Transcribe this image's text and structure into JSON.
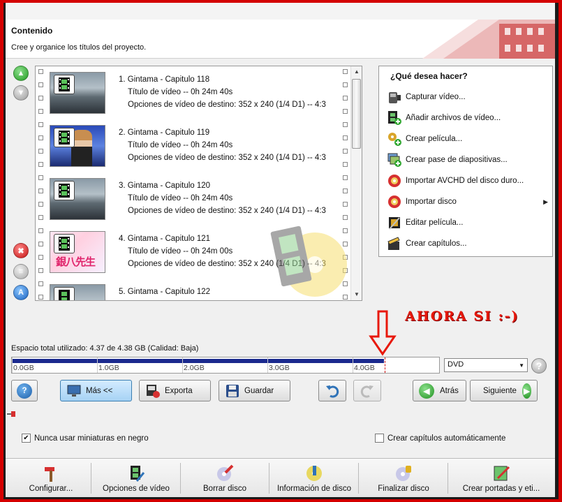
{
  "header": {
    "title": "Contenido",
    "subtitle": "Cree y organice los títulos del proyecto."
  },
  "titles": [
    {
      "name": "1. Gintama - Capitulo 118",
      "duration": "Título de vídeo -- 0h 24m 40s",
      "options": "Opciones de vídeo de destino: 352 x 240 (1/4 D1) -- 4:3"
    },
    {
      "name": "2. Gintama - Capitulo 119",
      "duration": "Título de vídeo -- 0h 24m 40s",
      "options": "Opciones de vídeo de destino: 352 x 240 (1/4 D1) -- 4:3"
    },
    {
      "name": "3. Gintama - Capitulo 120",
      "duration": "Título de vídeo -- 0h 24m 40s",
      "options": "Opciones de vídeo de destino: 352 x 240 (1/4 D1) -- 4:3"
    },
    {
      "name": "4. Gintama - Capitulo 121",
      "duration": "Título de vídeo -- 0h 24m 00s",
      "options": "Opciones de vídeo de destino: 352 x 240 (1/4 D1) -- 4:3"
    },
    {
      "name": "5. Gintama - Capitulo 122",
      "duration": "",
      "options": ""
    }
  ],
  "thumb_text": {
    "anime2": "銀八先生"
  },
  "tasks": {
    "heading": "¿Qué desea hacer?",
    "items": [
      {
        "label": "Capturar vídeo...",
        "icon": "camcorder-icon"
      },
      {
        "label": "Añadir archivos de vídeo...",
        "icon": "add-video-file-icon"
      },
      {
        "label": "Crear película...",
        "icon": "create-movie-icon"
      },
      {
        "label": "Crear pase de diapositivas...",
        "icon": "slideshow-icon"
      },
      {
        "label": "Importar AVCHD del disco duro...",
        "icon": "import-avchd-icon"
      },
      {
        "label": "Importar disco",
        "icon": "import-disc-icon",
        "submenu": "▶"
      },
      {
        "label": "Editar película...",
        "icon": "edit-movie-icon"
      },
      {
        "label": "Crear capítulos...",
        "icon": "chapters-icon"
      }
    ]
  },
  "annotation": "AHORA SI :-)",
  "space": {
    "label": "Espacio total utilizado: 4.37 de 4.38 GB (Calidad: Baja)",
    "used_gb": 4.37,
    "capacity_gb": 4.38,
    "ticks": [
      "0.0GB",
      "1.0GB",
      "2.0GB",
      "3.0GB",
      "4.0GB"
    ]
  },
  "disc_type": "DVD",
  "buttons": {
    "help": "?",
    "more": "Más <<",
    "export": "Exporta",
    "save": "Guardar",
    "back": "Atrás",
    "next": "Siguiente"
  },
  "options": {
    "no_black_thumbs": {
      "label": "Nunca usar miniaturas en negro",
      "checked": true
    },
    "auto_chapters": {
      "label": "Crear capítulos automáticamente",
      "checked": false
    }
  },
  "toolbar": [
    {
      "label": "Configurar...",
      "icon": "hammer-icon"
    },
    {
      "label": "Opciones de vídeo",
      "icon": "video-options-icon"
    },
    {
      "label": "Borrar disco",
      "icon": "erase-disc-icon"
    },
    {
      "label": "Información de disco",
      "icon": "disc-info-icon"
    },
    {
      "label": "Finalizar disco",
      "icon": "finalize-disc-icon"
    },
    {
      "label": "Crear portadas y eti...",
      "icon": "cover-labels-icon"
    }
  ],
  "colors": {
    "accent": "#1b2a8e",
    "annotation": "#e8180c",
    "frame": "#d40000"
  }
}
